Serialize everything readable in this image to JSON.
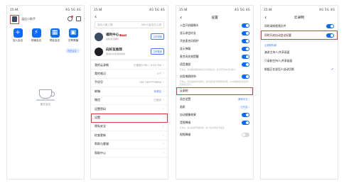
{
  "status": {
    "time": "15:44",
    "signal": "4G 5G 4G"
  },
  "screen1": {
    "username": "温达小助手",
    "actions": [
      {
        "icon": "plus-icon",
        "glyph": "+",
        "label": "加入会议"
      },
      {
        "icon": "lightning-icon",
        "glyph": "⚡",
        "label": "快速会议"
      },
      {
        "icon": "calendar-icon",
        "glyph": "▦",
        "label": "预定会议"
      },
      {
        "icon": "screen-share-icon",
        "glyph": "▣",
        "label": "共享屏幕"
      }
    ],
    "history_pill": "历史会议 ›",
    "empty_text": "暂无会议"
  },
  "screen2": {
    "search_placeholder": "会议人数上限",
    "search_hint": "300人会议已上线",
    "cards": [
      {
        "title": "福利中心",
        "badge": "NEW",
        "sub": "领取会员福利",
        "button": "立即领取",
        "color": "#3b4b63"
      },
      {
        "title": "向好友推荐",
        "sub": "邀请好友使用得奖励",
        "button": "立即推荐",
        "color": "#1d1f24"
      }
    ],
    "rows": [
      {
        "label": "我的云录制",
        "value": "已使用0 MB / 1024 MB"
      },
      {
        "label": "我的笔记",
        "value": "0个"
      },
      {
        "label": "手机号",
        "value": "+86 188****8888"
      },
      {
        "label": "邮箱",
        "value": "未绑定",
        "blue": true
      },
      {
        "label": "微信",
        "value": "已绑定"
      },
      {
        "label": "设置密码",
        "value": ""
      },
      {
        "label": "设置",
        "value": "",
        "highlight": true
      },
      {
        "label": "隐私安全",
        "value": ""
      },
      {
        "label": "检查更新",
        "value": ""
      },
      {
        "label": "帮助与客服",
        "value": ""
      },
      {
        "label": "帮助中心",
        "value": ""
      }
    ]
  },
  "screen3": {
    "title": "设置",
    "rows": [
      {
        "label": "入会开启摄像头",
        "on": true
      },
      {
        "label": "显示参会时长",
        "on": true
      },
      {
        "label": "开启麦克风保护",
        "on": true
      },
      {
        "label": "显示弹幕",
        "on": true
      },
      {
        "label": "麦克风失效提醒",
        "on": true
      },
      {
        "label": "语音激励",
        "on": true
      }
    ],
    "note": "开启后，会议视频画面中将显示说话者标识，麦克风开启时显示提示。",
    "rows2": [
      {
        "label": "启用美颜修饰",
        "on": true
      }
    ],
    "note2": "开启后，使用美颜修饰功能时，会对面部进行智能修饰处理，Ruisi视频将会在美颜开启状态下显示。",
    "cloud_row": "云录制",
    "rows3": [
      {
        "label": "语言设置",
        "value": "简体中文"
      },
      {
        "label": "画质",
        "value": "已开启"
      },
      {
        "label": "自动镜像效果",
        "on": true
      },
      {
        "label": "音频降噪",
        "on": true
      }
    ],
    "note3": "开启后，将自动进行降噪处理，减少会议中的背景噪音。",
    "last_row": {
      "label": "视频降噪",
      "on": false
    }
  },
  "screen4": {
    "title": "云录制",
    "rows": [
      {
        "label": "同时录制视频文件",
        "on": true
      },
      {
        "label": "同时开启自动会议纪要",
        "on": true,
        "highlight": true
      }
    ],
    "section": "云录制布局",
    "options": [
      {
        "label": "演讲主持人/共享画面",
        "checked": false
      },
      {
        "label": "只录制主持人/共享画面",
        "checked": false
      },
      {
        "label": "根据正在说话人自动切换",
        "checked": true
      }
    ]
  }
}
